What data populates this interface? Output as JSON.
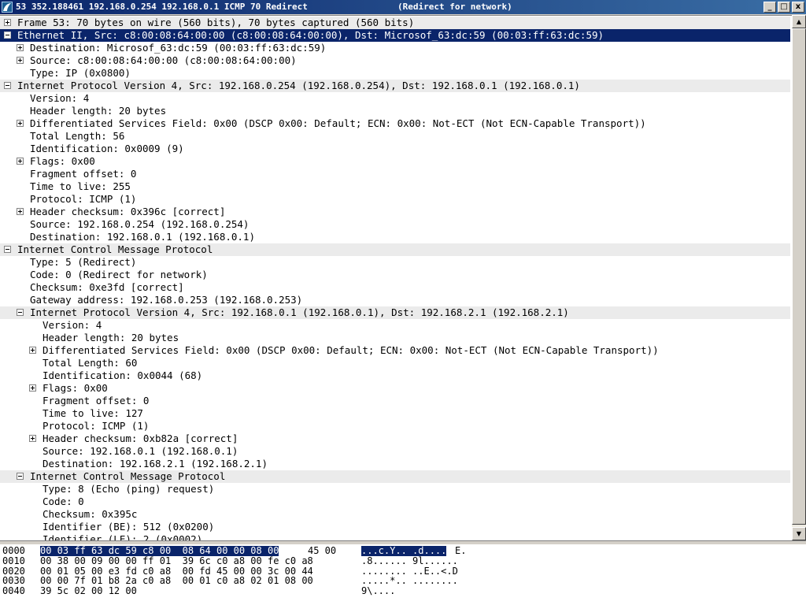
{
  "window": {
    "title_left": "53 352.188461 192.168.0.254 192.168.0.1 ICMP 70 Redirect",
    "title_right": "(Redirect for network)",
    "minimize_glyph": "_",
    "maximize_glyph": "□",
    "close_glyph": "x"
  },
  "tree": [
    {
      "level": 0,
      "expander": "plus",
      "kind": "header",
      "text": "Frame 53: 70 bytes on wire (560 bits), 70 bytes captured (560 bits)"
    },
    {
      "level": 0,
      "expander": "minus",
      "kind": "selected",
      "text": "Ethernet II, Src: c8:00:08:64:00:00 (c8:00:08:64:00:00), Dst: Microsof_63:dc:59 (00:03:ff:63:dc:59)"
    },
    {
      "level": 1,
      "expander": "plus",
      "text": "Destination: Microsof_63:dc:59 (00:03:ff:63:dc:59)"
    },
    {
      "level": 1,
      "expander": "plus",
      "text": "Source: c8:00:08:64:00:00 (c8:00:08:64:00:00)"
    },
    {
      "level": 1,
      "expander": "none",
      "text": "Type: IP (0x0800)"
    },
    {
      "level": 0,
      "expander": "minus",
      "kind": "header",
      "text": "Internet Protocol Version 4, Src: 192.168.0.254 (192.168.0.254), Dst: 192.168.0.1 (192.168.0.1)"
    },
    {
      "level": 1,
      "expander": "none",
      "text": "Version: 4"
    },
    {
      "level": 1,
      "expander": "none",
      "text": "Header length: 20 bytes"
    },
    {
      "level": 1,
      "expander": "plus",
      "text": "Differentiated Services Field: 0x00 (DSCP 0x00: Default; ECN: 0x00: Not-ECT (Not ECN-Capable Transport))"
    },
    {
      "level": 1,
      "expander": "none",
      "text": "Total Length: 56"
    },
    {
      "level": 1,
      "expander": "none",
      "text": "Identification: 0x0009 (9)"
    },
    {
      "level": 1,
      "expander": "plus",
      "text": "Flags: 0x00"
    },
    {
      "level": 1,
      "expander": "none",
      "text": "Fragment offset: 0"
    },
    {
      "level": 1,
      "expander": "none",
      "text": "Time to live: 255"
    },
    {
      "level": 1,
      "expander": "none",
      "text": "Protocol: ICMP (1)"
    },
    {
      "level": 1,
      "expander": "plus",
      "text": "Header checksum: 0x396c [correct]"
    },
    {
      "level": 1,
      "expander": "none",
      "text": "Source: 192.168.0.254 (192.168.0.254)"
    },
    {
      "level": 1,
      "expander": "none",
      "text": "Destination: 192.168.0.1 (192.168.0.1)"
    },
    {
      "level": 0,
      "expander": "minus",
      "kind": "header",
      "text": "Internet Control Message Protocol"
    },
    {
      "level": 1,
      "expander": "none",
      "text": "Type: 5 (Redirect)"
    },
    {
      "level": 1,
      "expander": "none",
      "text": "Code: 0 (Redirect for network)"
    },
    {
      "level": 1,
      "expander": "none",
      "text": "Checksum: 0xe3fd [correct]"
    },
    {
      "level": 1,
      "expander": "none",
      "text": "Gateway address: 192.168.0.253 (192.168.0.253)"
    },
    {
      "level": 1,
      "expander": "minus",
      "kind": "header",
      "text": "Internet Protocol Version 4, Src: 192.168.0.1 (192.168.0.1), Dst: 192.168.2.1 (192.168.2.1)"
    },
    {
      "level": 2,
      "expander": "none",
      "text": "Version: 4"
    },
    {
      "level": 2,
      "expander": "none",
      "text": "Header length: 20 bytes"
    },
    {
      "level": 2,
      "expander": "plus",
      "text": "Differentiated Services Field: 0x00 (DSCP 0x00: Default; ECN: 0x00: Not-ECT (Not ECN-Capable Transport))"
    },
    {
      "level": 2,
      "expander": "none",
      "text": "Total Length: 60"
    },
    {
      "level": 2,
      "expander": "none",
      "text": "Identification: 0x0044 (68)"
    },
    {
      "level": 2,
      "expander": "plus",
      "text": "Flags: 0x00"
    },
    {
      "level": 2,
      "expander": "none",
      "text": "Fragment offset: 0"
    },
    {
      "level": 2,
      "expander": "none",
      "text": "Time to live: 127"
    },
    {
      "level": 2,
      "expander": "none",
      "text": "Protocol: ICMP (1)"
    },
    {
      "level": 2,
      "expander": "plus",
      "text": "Header checksum: 0xb82a [correct]"
    },
    {
      "level": 2,
      "expander": "none",
      "text": "Source: 192.168.0.1 (192.168.0.1)"
    },
    {
      "level": 2,
      "expander": "none",
      "text": "Destination: 192.168.2.1 (192.168.2.1)"
    },
    {
      "level": 1,
      "expander": "minus",
      "kind": "header",
      "text": "Internet Control Message Protocol"
    },
    {
      "level": 2,
      "expander": "none",
      "text": "Type: 8 (Echo (ping) request)"
    },
    {
      "level": 2,
      "expander": "none",
      "text": "Code: 0"
    },
    {
      "level": 2,
      "expander": "none",
      "text": "Checksum: 0x395c"
    },
    {
      "level": 2,
      "expander": "none",
      "text": "Identifier (BE): 512 (0x0200)"
    },
    {
      "level": 2,
      "expander": "none",
      "text": "Identifier (LE): 2 (0x0002)"
    }
  ],
  "hex_dump": [
    {
      "offset": "0000",
      "hex_sel": "00 03 ff 63 dc 59 c8 00  08 64 00 00 08 00",
      "hex_rest": "45 00",
      "ascii_sel": "...c.Y.. .d....",
      "ascii_rest": "E."
    },
    {
      "offset": "0010",
      "hex_sel": "",
      "hex_rest": "00 38 00 09 00 00 ff 01  39 6c c0 a8 00 fe c0 a8",
      "ascii_sel": "",
      "ascii_rest": ".8...... 9l......"
    },
    {
      "offset": "0020",
      "hex_sel": "",
      "hex_rest": "00 01 05 00 e3 fd c0 a8  00 fd 45 00 00 3c 00 44",
      "ascii_sel": "",
      "ascii_rest": "........ ..E..<.D"
    },
    {
      "offset": "0030",
      "hex_sel": "",
      "hex_rest": "00 00 7f 01 b8 2a c0 a8  00 01 c0 a8 02 01 08 00",
      "ascii_sel": "",
      "ascii_rest": ".....*.. ........"
    },
    {
      "offset": "0040",
      "hex_sel": "",
      "hex_rest": "39 5c 02 00 12 00",
      "ascii_sel": "",
      "ascii_rest": "9\\...."
    }
  ],
  "scrollbar": {
    "up_glyph": "▲",
    "down_glyph": "▼"
  }
}
